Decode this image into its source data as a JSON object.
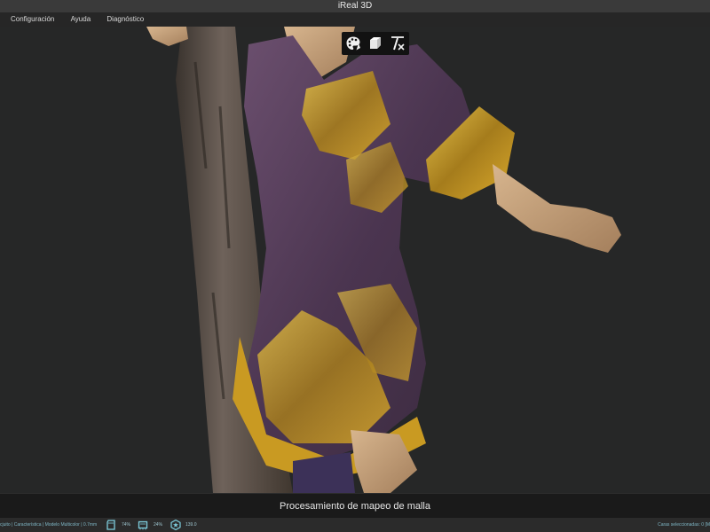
{
  "window": {
    "title": "iReal 3D"
  },
  "menu": {
    "items": [
      "Configuración",
      "Ayuda",
      "Diagnóstico"
    ]
  },
  "toolbar": {
    "icons": [
      "palette-icon",
      "cube-icon",
      "clear-formatting-icon"
    ]
  },
  "process": {
    "label": "Procesamiento de mapeo de malla"
  },
  "status": {
    "mode_text": "cjuito | Característica | Modelo Multicolor | 0.7mm",
    "disk": {
      "icon": "sd-card-icon",
      "value": "74%"
    },
    "memory": {
      "icon": "memory-icon",
      "value": "24%"
    },
    "fps": {
      "icon": "star-badge-icon",
      "value": "139.0"
    },
    "selection": "Caras seleccionadas: 0 [M"
  },
  "colors": {
    "titlebar_bg": "#3a3a3a",
    "viewport_bg": "#262727",
    "status_accent": "#7fb7c6",
    "gold": "#c9a12a",
    "robe_purple": "#5a3f5a"
  }
}
